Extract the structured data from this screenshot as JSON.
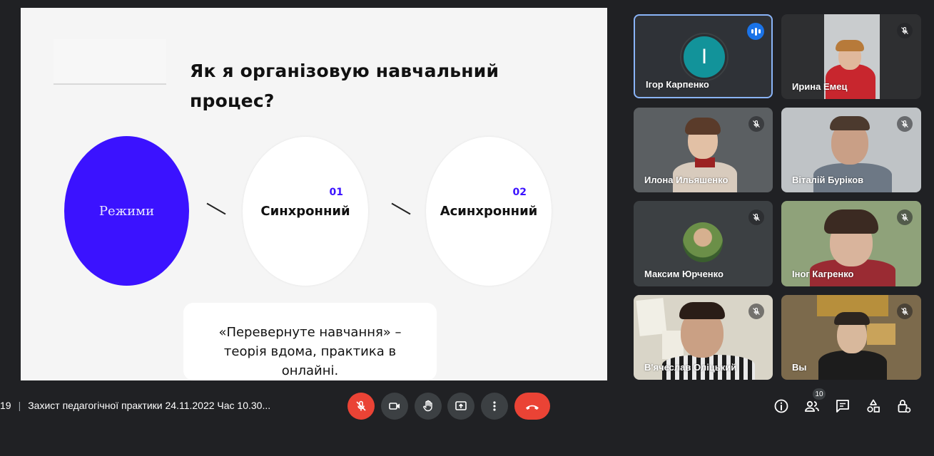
{
  "slide": {
    "title": "Як я організовую навчальний процес?",
    "main_circle_label": "Режими",
    "options": [
      {
        "number": "01",
        "label": "Синхронний"
      },
      {
        "number": "02",
        "label": "Асинхронний"
      }
    ],
    "note": "«Перевернуте навчання» – теорія вдома, практика в онлайні."
  },
  "participants": [
    {
      "name": "Ігор Карпенко",
      "initial": "І",
      "speaking": true
    },
    {
      "name": "Ирина Емец",
      "muted": true
    },
    {
      "name": "Илона Ильяшенко",
      "muted": true
    },
    {
      "name": "Віталій Буріков",
      "muted": true
    },
    {
      "name": "Максим Юрченко",
      "muted": true
    },
    {
      "name": "Іног Кагренко",
      "muted": true
    },
    {
      "name": "В'ячеслав Оліцький",
      "muted": true
    },
    {
      "name": "Вы",
      "muted": true
    }
  ],
  "meeting": {
    "time_fragment": "19",
    "separator": "|",
    "title": "Захист педагогічної практики 24.11.2022 Час 10.30...",
    "participant_count": "10"
  },
  "controls": {
    "icons": [
      "mic-off-icon",
      "camera-icon",
      "raise-hand-icon",
      "present-screen-icon",
      "more-options-icon",
      "hang-up-icon"
    ],
    "right_icons": [
      "info-icon",
      "people-icon",
      "chat-icon",
      "activities-icon",
      "host-controls-icon"
    ]
  },
  "colors": {
    "background": "#202124",
    "accent_blue": "#3b12ff",
    "danger": "#ea4335",
    "speaking": "#1a73e8",
    "avatar": "#12939a"
  }
}
